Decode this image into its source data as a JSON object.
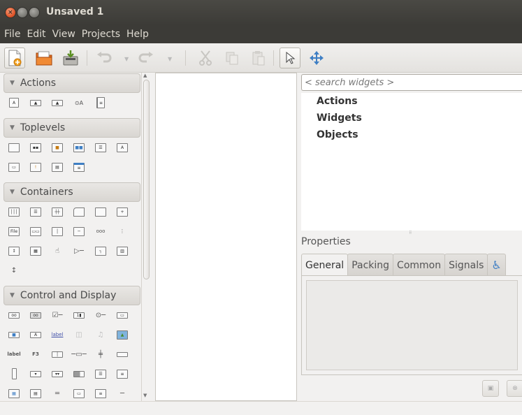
{
  "window": {
    "title": "Unsaved 1",
    "close": "×"
  },
  "menu": [
    "File",
    "Edit",
    "View",
    "Projects",
    "Help"
  ],
  "toolbar": {
    "icons": [
      "new-file-icon",
      "open-folder-icon",
      "save-icon",
      "undo-icon",
      "redo-icon",
      "cut-icon",
      "copy-icon",
      "paste-icon",
      "select-pointer-icon",
      "drag-resize-icon"
    ]
  },
  "palette": {
    "sections": [
      {
        "label": "Actions"
      },
      {
        "label": "Toplevels"
      },
      {
        "label": "Containers"
      },
      {
        "label": "Control and Display"
      }
    ],
    "glyph_labels": {
      "file": "File",
      "label": "label",
      "f3": "F3",
      "ooo": "ooo"
    }
  },
  "inspector": {
    "search_placeholder": "< search widgets >",
    "tree": [
      "Actions",
      "Widgets",
      "Objects"
    ]
  },
  "properties": {
    "label": "Properties",
    "tabs": [
      "General",
      "Packing",
      "Common",
      "Signals"
    ],
    "accessibility_icon": "♿"
  }
}
